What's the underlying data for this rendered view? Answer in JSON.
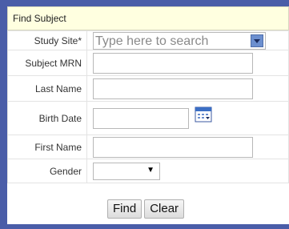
{
  "header": {
    "title": "Find Subject"
  },
  "fields": {
    "study_site": {
      "label": "Study Site*",
      "placeholder": "Type here to search"
    },
    "subject_mrn": {
      "label": "Subject MRN",
      "value": ""
    },
    "last_name": {
      "label": "Last Name",
      "value": ""
    },
    "birth_date": {
      "label": "Birth Date",
      "value": ""
    },
    "first_name": {
      "label": "First Name",
      "value": ""
    },
    "gender": {
      "label": "Gender",
      "value": ""
    }
  },
  "buttons": {
    "find": "Find",
    "clear": "Clear"
  },
  "icons": {
    "dropdown": "dropdown-arrow-icon",
    "calendar": "calendar-icon",
    "gender_caret": "caret-down-icon"
  },
  "colors": {
    "frame": "#4a5da8",
    "header_bg": "#ffffe0",
    "dropdown_button": "#6c8fcf"
  }
}
